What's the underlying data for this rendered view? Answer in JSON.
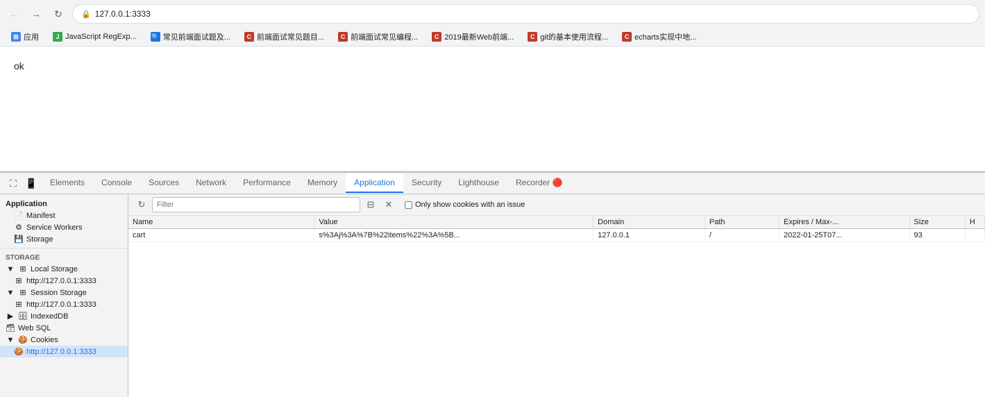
{
  "browser": {
    "url": "127.0.0.1:3333",
    "bookmarks": [
      {
        "label": "应用",
        "type": "apps"
      },
      {
        "label": "JavaScript RegExp...",
        "type": "green"
      },
      {
        "label": "常见前端面试题及...",
        "type": "blue"
      },
      {
        "label": "前端面试常见题目...",
        "type": "csdn"
      },
      {
        "label": "前端面试常见编程...",
        "type": "csdn"
      },
      {
        "label": "2019最新Web前端...",
        "type": "csdn"
      },
      {
        "label": "git的基本使用流程...",
        "type": "csdn"
      },
      {
        "label": "echarts实现中地...",
        "type": "csdn"
      }
    ]
  },
  "page": {
    "content": "ok"
  },
  "devtools": {
    "tabs": [
      {
        "label": "Elements",
        "active": false
      },
      {
        "label": "Console",
        "active": false
      },
      {
        "label": "Sources",
        "active": false
      },
      {
        "label": "Network",
        "active": false
      },
      {
        "label": "Performance",
        "active": false
      },
      {
        "label": "Memory",
        "active": false
      },
      {
        "label": "Application",
        "active": true
      },
      {
        "label": "Security",
        "active": false
      },
      {
        "label": "Lighthouse",
        "active": false
      },
      {
        "label": "Recorder 🔴",
        "active": false
      }
    ],
    "sidebar": {
      "applicationSection": "Application",
      "items": [
        {
          "label": "Manifest",
          "icon": "📄",
          "indent": 1
        },
        {
          "label": "Service Workers",
          "icon": "⚙",
          "indent": 1
        },
        {
          "label": "Storage",
          "icon": "💾",
          "indent": 1
        }
      ],
      "storageSection": "Storage",
      "storageItems": [
        {
          "label": "Local Storage",
          "icon": "▼",
          "indent": 0,
          "expanded": true
        },
        {
          "label": "http://127.0.0.1:3333",
          "icon": "",
          "indent": 1,
          "sub": true
        },
        {
          "label": "Session Storage",
          "icon": "▼",
          "indent": 0,
          "expanded": true
        },
        {
          "label": "http://127.0.0.1:3333",
          "icon": "",
          "indent": 1,
          "sub": true
        },
        {
          "label": "IndexedDB",
          "icon": "🗄",
          "indent": 0
        },
        {
          "label": "Web SQL",
          "icon": "🗃",
          "indent": 0
        },
        {
          "label": "Cookies",
          "icon": "▼",
          "indent": 0,
          "expanded": true
        },
        {
          "label": "http://127.0.0.1:3333",
          "icon": "",
          "indent": 1,
          "sub": true,
          "selected": true
        }
      ]
    },
    "cookiePanel": {
      "filterPlaceholder": "Filter",
      "onlyShowIssuesLabel": "Only show cookies with an issue",
      "columns": [
        "Name",
        "Value",
        "Domain",
        "Path",
        "Expires / Max-...",
        "Size",
        "H"
      ],
      "rows": [
        {
          "name": "cart",
          "value": "s%3Aj%3A%7B%22items%22%3A%5B...",
          "domain": "127.0.0.1",
          "path": "/",
          "expires": "2022-01-25T07...",
          "size": "93",
          "h": ""
        }
      ]
    }
  }
}
